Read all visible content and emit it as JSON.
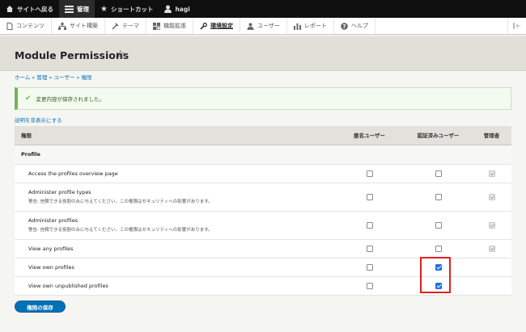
{
  "toolbar": {
    "back_label": "サイトへ戻る",
    "manage_label": "管理",
    "shortcut_label": "ショートカット",
    "user_label": "hagi"
  },
  "tray": [
    {
      "label": "コンテンツ",
      "icon": "content-icon"
    },
    {
      "label": "サイト構築",
      "icon": "structure-icon"
    },
    {
      "label": "テーマ",
      "icon": "appearance-icon"
    },
    {
      "label": "機能拡張",
      "icon": "extend-icon"
    },
    {
      "label": "環境設定",
      "icon": "config-icon"
    },
    {
      "label": "ユーザー",
      "icon": "people-icon"
    },
    {
      "label": "レポート",
      "icon": "reports-icon"
    },
    {
      "label": "ヘルプ",
      "icon": "help-icon"
    }
  ],
  "page": {
    "title": "Module Permissions",
    "breadcrumb": "ホーム » 管理 » ユーザー » 権限",
    "status": "変更内容が保存されました。",
    "hide_desc": "説明を非表示にする",
    "save_label": "権限の保存"
  },
  "table": {
    "headers": {
      "perm": "権限",
      "anon": "匿名ユーザー",
      "auth": "認証済みユーザー",
      "admin": "管理者"
    },
    "module_name": "Profile",
    "warning": "警告: 信頼できる役割のみに与えてください。この権限はセキュリティへの影響があります。",
    "rows": [
      {
        "name": "Access the profiles overview page",
        "anon": false,
        "auth": false,
        "admin": true
      },
      {
        "name": "Administer profile types",
        "anon": false,
        "auth": false,
        "admin": true
      },
      {
        "name": "Administer profiles",
        "anon": false,
        "auth": false,
        "admin": true
      },
      {
        "name": "View any profiles",
        "anon": false,
        "auth": false,
        "admin": true
      },
      {
        "name": "View own profiles",
        "anon": false,
        "auth": true,
        "admin": false
      },
      {
        "name": "View own unpublished profiles",
        "anon": false,
        "auth": true,
        "admin": false
      }
    ]
  },
  "colors": {
    "link": "#0074bd",
    "accent_button": "#0071b8",
    "status_border": "#77b259",
    "highlight": "#e02020"
  }
}
